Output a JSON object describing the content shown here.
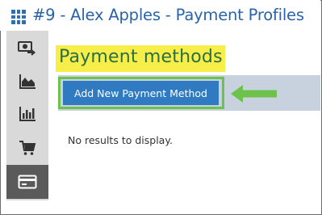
{
  "header": {
    "title": "#9 - Alex Apples - Payment Profiles",
    "menu_icon": "grid-menu-icon"
  },
  "sidebar": {
    "items": [
      {
        "name": "payments",
        "icon": "money-refund-icon",
        "active": false
      },
      {
        "name": "analytics",
        "icon": "area-chart-icon",
        "active": false
      },
      {
        "name": "reports",
        "icon": "bar-chart-icon",
        "active": false
      },
      {
        "name": "orders",
        "icon": "shopping-cart-icon",
        "active": false
      },
      {
        "name": "payment-profiles",
        "icon": "credit-card-icon",
        "active": true
      }
    ]
  },
  "main": {
    "section_title": "Payment methods",
    "add_button_label": "Add New Payment Method",
    "empty_message": "No results to display."
  },
  "colors": {
    "title": "#2a63a8",
    "highlight": "#f7ee4a",
    "section_title": "#2c6e44",
    "button": "#2f7ac1",
    "annotation": "#6cc24a",
    "action_bar": "#c7d2de",
    "sidebar": "#d9d9d9",
    "sidebar_active": "#5a5a5a"
  }
}
